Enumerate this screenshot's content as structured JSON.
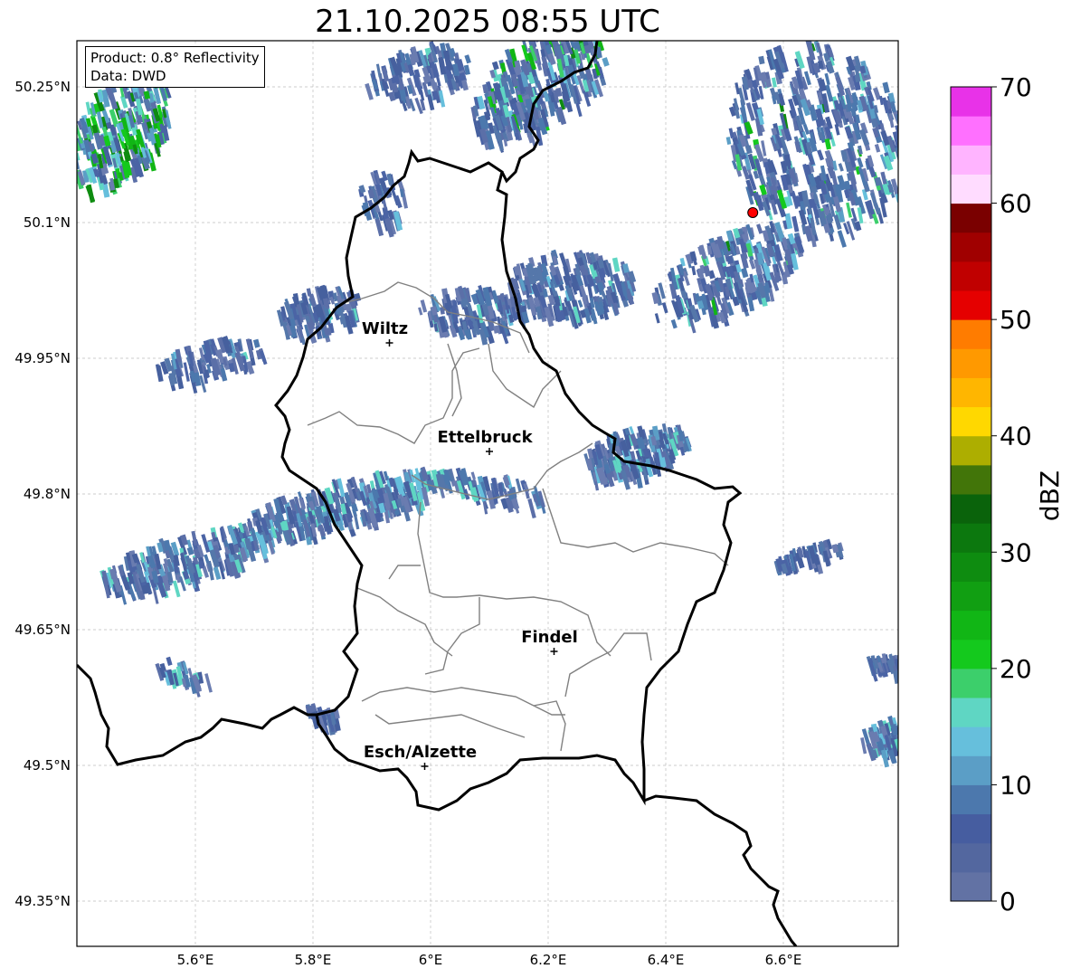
{
  "title": "21.10.2025 08:55 UTC",
  "info": {
    "product": "Product: 0.8° Reflectivity",
    "data": "Data: DWD"
  },
  "lat_ticks": [
    {
      "value": 50.25,
      "label": "50.25°N"
    },
    {
      "value": 50.1,
      "label": "50.1°N"
    },
    {
      "value": 49.95,
      "label": "49.95°N"
    },
    {
      "value": 49.8,
      "label": "49.8°N"
    },
    {
      "value": 49.65,
      "label": "49.65°N"
    },
    {
      "value": 49.5,
      "label": "49.5°N"
    },
    {
      "value": 49.35,
      "label": "49.35°N"
    }
  ],
  "lon_ticks": [
    {
      "value": 5.6,
      "label": "5.6°E"
    },
    {
      "value": 5.8,
      "label": "5.8°E"
    },
    {
      "value": 6.0,
      "label": "6°E"
    },
    {
      "value": 6.2,
      "label": "6.2°E"
    },
    {
      "value": 6.4,
      "label": "6.4°E"
    },
    {
      "value": 6.6,
      "label": "6.6°E"
    }
  ],
  "cities": [
    {
      "name": "Wiltz",
      "lon": 5.93,
      "lat": 49.967
    },
    {
      "name": "Ettelbruck",
      "lon": 6.1,
      "lat": 49.847
    },
    {
      "name": "Findel",
      "lon": 6.21,
      "lat": 49.626
    },
    {
      "name": "Esch/Alzette",
      "lon": 5.99,
      "lat": 49.499
    }
  ],
  "radar_site": {
    "lon": 6.548,
    "lat": 50.111
  },
  "colorbar": {
    "label": "dBZ",
    "ticks": [
      "0",
      "10",
      "20",
      "30",
      "40",
      "50",
      "60",
      "70"
    ],
    "colors": [
      "#6272a4",
      "#53679f",
      "#465da0",
      "#4c78ad",
      "#5b9ec6",
      "#66bfdc",
      "#5fd6c3",
      "#3ccf6b",
      "#14c91d",
      "#11b615",
      "#119f12",
      "#0e8c10",
      "#0c780e",
      "#0a630b",
      "#427509",
      "#adae00",
      "#ffd800",
      "#ffb600",
      "#ff9900",
      "#ff7c00",
      "#e50000",
      "#c00000",
      "#a00000",
      "#7a0000",
      "#ffdcff",
      "#ffb4ff",
      "#ff70ff",
      "#e832e8"
    ]
  }
}
